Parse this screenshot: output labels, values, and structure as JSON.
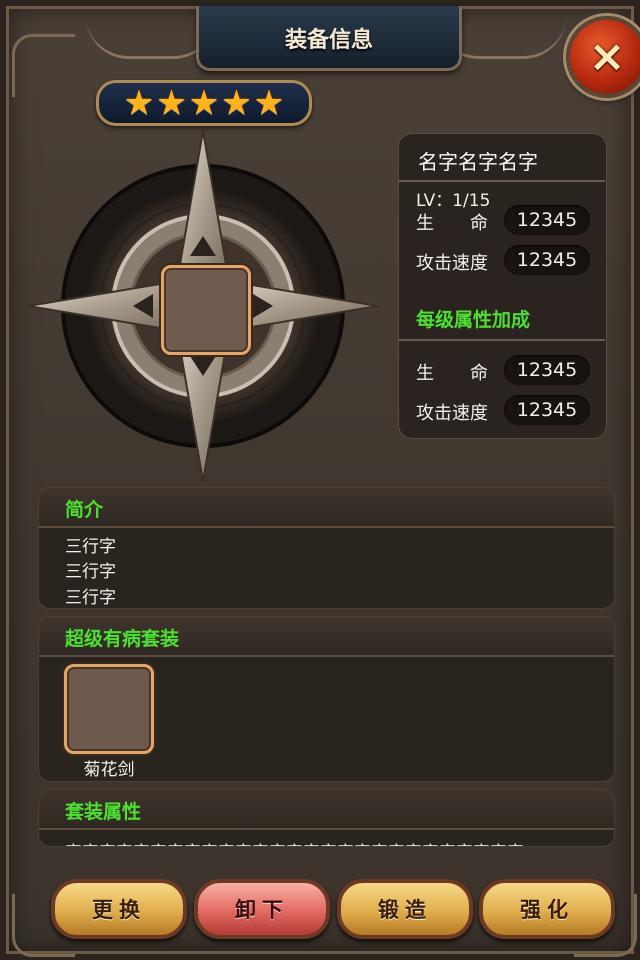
{
  "window": {
    "title": "装备信息",
    "close_icon": "×"
  },
  "rarity": {
    "stars": 5,
    "star_glyph": "★"
  },
  "item": {
    "name": "名字名字名字",
    "level": "LV：1/15",
    "stats": [
      {
        "label": "生　　命",
        "value": "12345"
      },
      {
        "label": "攻击速度",
        "value": "12345"
      }
    ]
  },
  "bonus": {
    "heading": "每级属性加成",
    "stats": [
      {
        "label": "生　　命",
        "value": "12345"
      },
      {
        "label": "攻击速度",
        "value": "12345"
      }
    ]
  },
  "intro": {
    "title": "简介",
    "lines": [
      "三行字",
      "三行字",
      "三行字"
    ]
  },
  "set": {
    "title": "超级有病套装",
    "items": [
      {
        "name": "菊花剑"
      }
    ]
  },
  "set_attr": {
    "title": "套装属性",
    "text": "字字字字字字字字字字字字字字字字字字字字字字字字字字字"
  },
  "buttons": {
    "replace": "更换",
    "unequip": "卸下",
    "forge": "锻造",
    "enhance": "强化"
  },
  "colors": {
    "accent_green": "#4de030",
    "star_gold": "#ffb21c",
    "close_red": "#b5280f"
  }
}
